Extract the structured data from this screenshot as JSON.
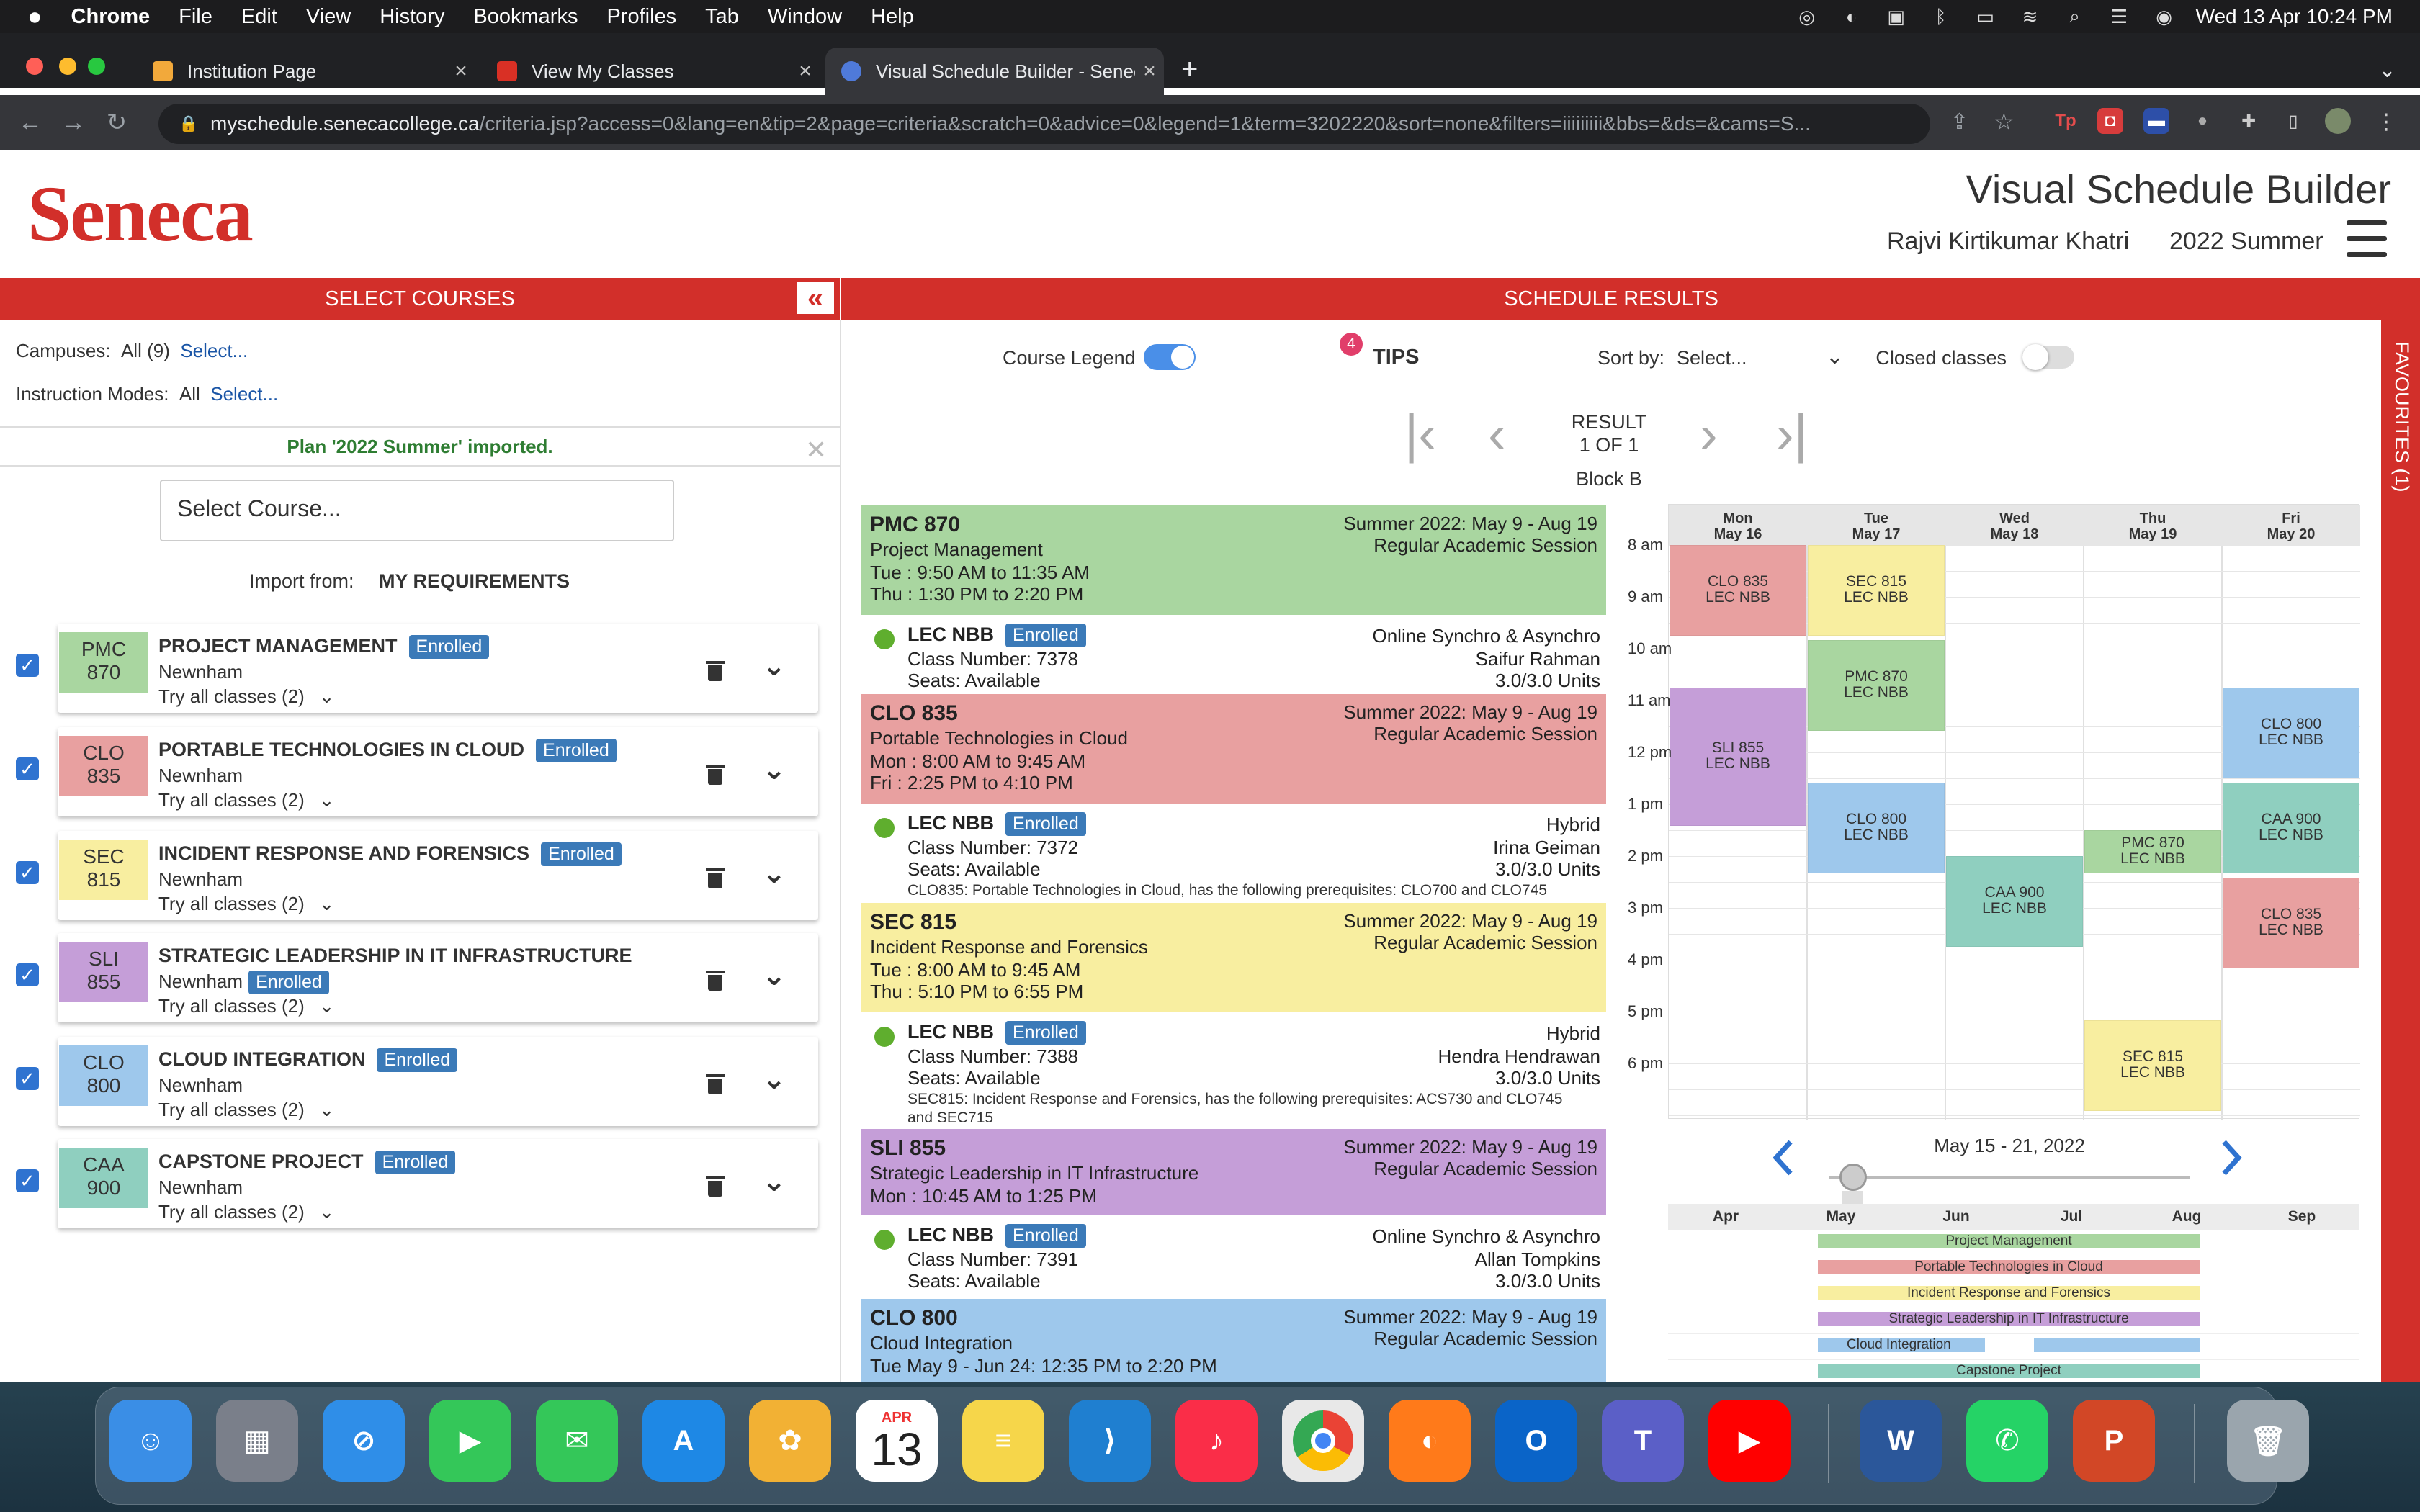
{
  "menubar": {
    "apple": "",
    "app": "Chrome",
    "items": [
      "File",
      "Edit",
      "View",
      "History",
      "Bookmarks",
      "Profiles",
      "Tab",
      "Window",
      "Help"
    ],
    "clock": "Wed 13 Apr  10:24 PM"
  },
  "tabs": [
    {
      "title": "Institution Page",
      "color": "#f2a93b"
    },
    {
      "title": "View My Classes",
      "color": "#d93025"
    },
    {
      "title": "Visual Schedule Builder - Senec",
      "color": "#4f7ad9"
    }
  ],
  "new_tab": "+",
  "url": {
    "host": "myschedule.senecacollege.ca",
    "path": "/criteria.jsp?access=0&lang=en&tip=2&page=criteria&scratch=0&advice=0&legend=1&term=3202220&sort=none&filters=iiiiiiiii&bbs=&ds=&cams=S..."
  },
  "header": {
    "logo": "Seneca",
    "title": "Visual Schedule Builder",
    "user": "Rajvi Kirtikumar Khatri",
    "term": "2022 Summer"
  },
  "left": {
    "bar": "SELECT COURSES",
    "collapse": "«",
    "campuses_label": "Campuses:",
    "campuses_value": "All (9)",
    "campuses_link": "Select...",
    "modes_label": "Instruction Modes:",
    "modes_value": "All",
    "modes_link": "Select...",
    "imported": "Plan '2022 Summer' imported.",
    "close": "✕",
    "select_course": "Select Course...",
    "import_label": "Import from:",
    "import_value": "MY REQUIREMENTS",
    "courses": [
      {
        "code1": "PMC",
        "code2": "870",
        "name": "PROJECT MANAGEMENT",
        "status": "Enrolled",
        "campus": "Newnham",
        "try": "Try all classes (2)",
        "color": "#a9d6a0"
      },
      {
        "code1": "CLO",
        "code2": "835",
        "name": "PORTABLE TECHNOLOGIES IN CLOUD",
        "status": "Enrolled",
        "campus": "Newnham",
        "try": "Try all classes (2)",
        "color": "#e8a0a0"
      },
      {
        "code1": "SEC",
        "code2": "815",
        "name": "INCIDENT RESPONSE AND FORENSICS",
        "status": "Enrolled",
        "campus": "Newnham",
        "try": "Try all classes (2)",
        "color": "#f8eea0"
      },
      {
        "code1": "SLI",
        "code2": "855",
        "name": "STRATEGIC LEADERSHIP IN IT INFRASTRUCTURE",
        "status": "Enrolled",
        "campus": "Newnham",
        "try": "Try all classes (2)",
        "color": "#c59ed8"
      },
      {
        "code1": "CLO",
        "code2": "800",
        "name": "CLOUD INTEGRATION",
        "status": "Enrolled",
        "campus": "Newnham",
        "try": "Try all classes (2)",
        "color": "#9ec8ec"
      },
      {
        "code1": "CAA",
        "code2": "900",
        "name": "CAPSTONE PROJECT",
        "status": "Enrolled",
        "campus": "Newnham",
        "try": "Try all classes (2)",
        "color": "#8fcfbf"
      }
    ]
  },
  "middle": {
    "bar": "SCHEDULE RESULTS",
    "legend_label": "Course Legend",
    "tips_count": "4",
    "tips": "TIPS",
    "sort_label": "Sort by:",
    "sort_value": "Select...",
    "closed_label": "Closed classes",
    "result_line1": "RESULT",
    "result_line2": "1 OF 1",
    "block": "Block B",
    "cards": [
      {
        "code": "PMC 870",
        "title": "Project Management",
        "l2": "Tue : 9:50 AM to 11:35 AM",
        "l3": "Thu : 1:30 PM to 2:20 PM",
        "term": "Summer 2022: May 9 - Aug 19",
        "session": "Regular Academic Session",
        "color": "#a9d6a0",
        "sec": {
          "lec": "LEC NBB",
          "status": "Enrolled",
          "classnum": "Class Number: 7378",
          "seats": "Seats: Available",
          "mode": "Online Synchro & Asynchro",
          "instructor": "Saifur Rahman",
          "units": "3.0/3.0 Units",
          "note": ""
        }
      },
      {
        "code": "CLO 835",
        "title": "Portable Technologies in Cloud",
        "l2": "Mon : 8:00 AM to 9:45 AM",
        "l3": "Fri : 2:25 PM to 4:10 PM",
        "term": "Summer 2022: May 9 - Aug 19",
        "session": "Regular Academic Session",
        "color": "#e8a0a0",
        "sec": {
          "lec": "LEC NBB",
          "status": "Enrolled",
          "classnum": "Class Number: 7372",
          "seats": "Seats: Available",
          "mode": "Hybrid",
          "instructor": "Irina Geiman",
          "units": "3.0/3.0 Units",
          "note": "CLO835: Portable Technologies in Cloud, has the following prerequisites: CLO700 and CLO745"
        }
      },
      {
        "code": "SEC 815",
        "title": "Incident Response and Forensics",
        "l2": "Tue : 8:00 AM to 9:45 AM",
        "l3": "Thu : 5:10 PM to 6:55 PM",
        "term": "Summer 2022: May 9 - Aug 19",
        "session": "Regular Academic Session",
        "color": "#f8eea0",
        "sec": {
          "lec": "LEC NBB",
          "status": "Enrolled",
          "classnum": "Class Number: 7388",
          "seats": "Seats: Available",
          "mode": "Hybrid",
          "instructor": "Hendra Hendrawan",
          "units": "3.0/3.0 Units",
          "note": "SEC815: Incident Response and Forensics, has the following prerequisites: ACS730 and CLO745 and SEC715"
        }
      },
      {
        "code": "SLI 855",
        "title": "Strategic Leadership in IT Infrastructure",
        "l2": "Mon : 10:45 AM to 1:25 PM",
        "l3": "",
        "term": "Summer 2022: May 9 - Aug 19",
        "session": "Regular Academic Session",
        "color": "#c59ed8",
        "sec": {
          "lec": "LEC NBB",
          "status": "Enrolled",
          "classnum": "Class Number: 7391",
          "seats": "Seats: Available",
          "mode": "Online Synchro & Asynchro",
          "instructor": "Allan Tompkins",
          "units": "3.0/3.0 Units",
          "note": ""
        }
      },
      {
        "code": "CLO 800",
        "title": "Cloud Integration",
        "l2": "Tue May 9 - Jun 24: 12:35 PM to 2:20 PM",
        "l3": "",
        "term": "Summer 2022: May 9 - Aug 19",
        "session": "Regular Academic Session",
        "color": "#9ec8ec"
      }
    ]
  },
  "calendar": {
    "days": [
      {
        "d": "Mon",
        "date": "May 16"
      },
      {
        "d": "Tue",
        "date": "May 17"
      },
      {
        "d": "Wed",
        "date": "May 18"
      },
      {
        "d": "Thu",
        "date": "May 19"
      },
      {
        "d": "Fri",
        "date": "May 20"
      }
    ],
    "hours": [
      "8 am",
      "9 am",
      "10 am",
      "11 am",
      "12 pm",
      "1 pm",
      "2 pm",
      "3 pm",
      "4 pm",
      "5 pm",
      "6 pm"
    ],
    "events": [
      {
        "l1": "CLO 835",
        "l2": "LEC NBB",
        "day": 0,
        "start": 8.0,
        "end": 9.75,
        "color": "#e8a0a0"
      },
      {
        "l1": "SLI 855",
        "l2": "LEC NBB",
        "day": 0,
        "start": 10.75,
        "end": 13.4167,
        "color": "#c59ed8"
      },
      {
        "l1": "SEC 815",
        "l2": "LEC NBB",
        "day": 1,
        "start": 8.0,
        "end": 9.75,
        "color": "#f8eea0"
      },
      {
        "l1": "PMC 870",
        "l2": "LEC NBB",
        "day": 1,
        "start": 9.8333,
        "end": 11.5833,
        "color": "#a9d6a0"
      },
      {
        "l1": "CLO 800",
        "l2": "LEC NBB",
        "day": 1,
        "start": 12.5833,
        "end": 14.3333,
        "color": "#9ec8ec"
      },
      {
        "l1": "CAA 900",
        "l2": "LEC NBB",
        "day": 2,
        "start": 14.0,
        "end": 15.75,
        "color": "#8fcfbf"
      },
      {
        "l1": "PMC 870",
        "l2": "LEC NBB",
        "day": 3,
        "start": 13.5,
        "end": 14.3333,
        "color": "#a9d6a0"
      },
      {
        "l1": "SEC 815",
        "l2": "LEC NBB",
        "day": 3,
        "start": 17.1667,
        "end": 18.9167,
        "color": "#f8eea0"
      },
      {
        "l1": "CLO 800",
        "l2": "LEC NBB",
        "day": 4,
        "start": 10.75,
        "end": 12.5,
        "color": "#9ec8ec"
      },
      {
        "l1": "CAA 900",
        "l2": "LEC NBB",
        "day": 4,
        "start": 12.5833,
        "end": 14.3333,
        "color": "#8fcfbf"
      },
      {
        "l1": "CLO 835",
        "l2": "LEC NBB",
        "day": 4,
        "start": 14.4167,
        "end": 16.1667,
        "color": "#e8a0a0"
      }
    ],
    "week_label": "May 15 - 21, 2022",
    "prev": "‹",
    "next": "›",
    "months": [
      "Apr",
      "May",
      "Jun",
      "Jul",
      "Aug",
      "Sep"
    ],
    "bars": [
      {
        "name": "Project Management",
        "color": "#a9d6a0"
      },
      {
        "name": "Portable Technologies in Cloud",
        "color": "#e8a0a0"
      },
      {
        "name": "Incident Response and Forensics",
        "color": "#f8eea0"
      },
      {
        "name": "Strategic Leadership in IT Infrastructure",
        "color": "#c59ed8"
      },
      {
        "name": "Cloud Integration",
        "color": "#9ec8ec"
      },
      {
        "name": "Capstone Project",
        "color": "#8fcfbf"
      }
    ]
  },
  "favourites": "FAVOURITES (1)",
  "dock": [
    {
      "name": "Finder",
      "color": "#3a8ee6"
    },
    {
      "name": "Launchpad",
      "color": "#7a7f8a"
    },
    {
      "name": "Safari",
      "color": "#2f8ee8"
    },
    {
      "name": "FaceTime",
      "color": "#34c759"
    },
    {
      "name": "Messages",
      "color": "#34c759"
    },
    {
      "name": "App Store",
      "color": "#1e88e5"
    },
    {
      "name": "Photos",
      "color": "#f2b134"
    },
    {
      "name": "Calendar",
      "color": "#ffffff"
    },
    {
      "name": "Notes",
      "color": "#f6d64a"
    },
    {
      "name": "VS Code",
      "color": "#1f7fd0"
    },
    {
      "name": "Music",
      "color": "#fa2d48"
    },
    {
      "name": "Chrome",
      "color": "#e8e8e8"
    },
    {
      "name": "Firefox",
      "color": "#ff7a1a"
    },
    {
      "name": "Outlook",
      "color": "#0a64c8"
    },
    {
      "name": "Teams",
      "color": "#5b5fc7"
    },
    {
      "name": "YouTube",
      "color": "#ff0000"
    },
    {
      "name": "Word",
      "color": "#2b579a"
    },
    {
      "name": "WhatsApp",
      "color": "#25d366"
    },
    {
      "name": "PowerPoint",
      "color": "#d24726"
    },
    {
      "name": "Trash",
      "color": "#9aa5ad"
    }
  ],
  "calendar_icon": {
    "month": "APR",
    "day": "13"
  }
}
